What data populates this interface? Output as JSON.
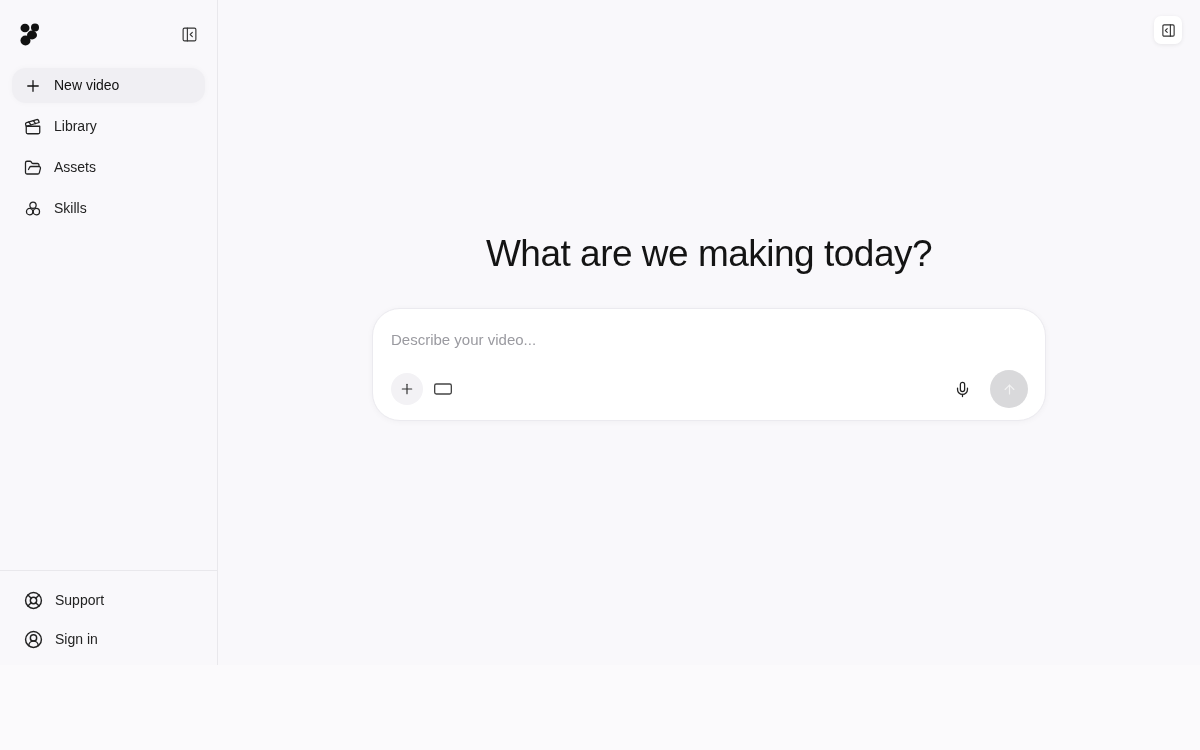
{
  "sidebar": {
    "items": [
      {
        "label": "New video",
        "selected": true
      },
      {
        "label": "Library",
        "selected": false
      },
      {
        "label": "Assets",
        "selected": false
      },
      {
        "label": "Skills",
        "selected": false
      }
    ],
    "footer_items": [
      {
        "label": "Support"
      },
      {
        "label": "Sign in"
      }
    ]
  },
  "main": {
    "heading": "What are we making today?",
    "composer": {
      "placeholder": "Describe your video..."
    }
  }
}
